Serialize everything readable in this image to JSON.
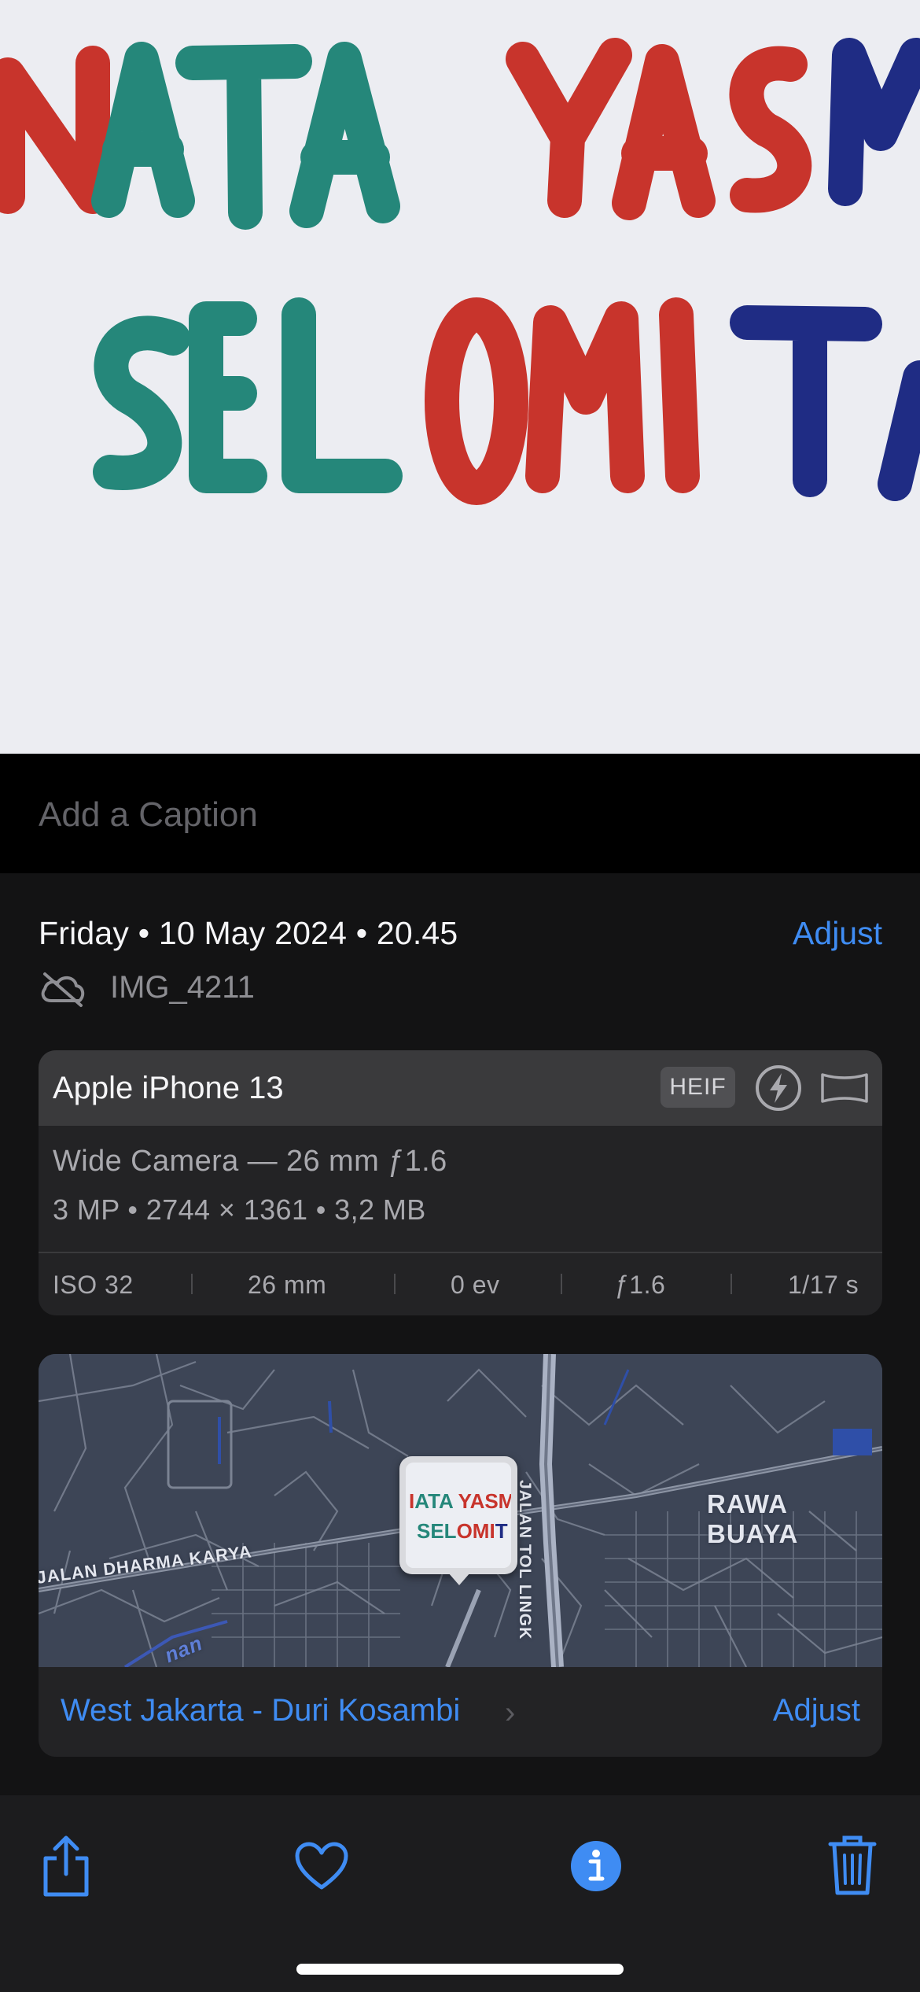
{
  "photo": {
    "line1": "NATA YASM",
    "line2": "SELOMITA",
    "colors": {
      "red": "#c8342c",
      "teal": "#25877a",
      "navy": "#1f2c84",
      "paper": "#ecedf2"
    }
  },
  "caption": {
    "placeholder": "Add a Caption"
  },
  "info": {
    "date": "Friday • 10 May 2024 • 20.45",
    "adjust_label": "Adjust",
    "filename": "IMG_4211",
    "status_icon": "cloud-slash-icon"
  },
  "camera": {
    "device": "Apple iPhone 13",
    "format_badge": "HEIF",
    "lens": "Wide Camera — 26 mm ƒ1.6",
    "meta": "3 MP  •  2744 × 1361  •  3,2 MB",
    "exif": [
      "ISO 32",
      "26 mm",
      "0 ev",
      "ƒ1.6",
      "1/17 s"
    ],
    "icons": [
      "flash-icon",
      "panorama-aspect-icon"
    ]
  },
  "map": {
    "labels": [
      "RAWA BUAYA",
      "JALAN DHARMA KARYA",
      "JALAN TOL LINGK",
      "nan"
    ],
    "location": "West Jakarta - Duri Kosambi",
    "adjust_label": "Adjust",
    "thumb_line1": "NATA YASM",
    "thumb_line2": "SELOMITA"
  },
  "toolbar": {
    "buttons": [
      "share-icon",
      "heart-icon",
      "info-icon",
      "trash-icon"
    ],
    "accent": "#3f8cf3"
  }
}
